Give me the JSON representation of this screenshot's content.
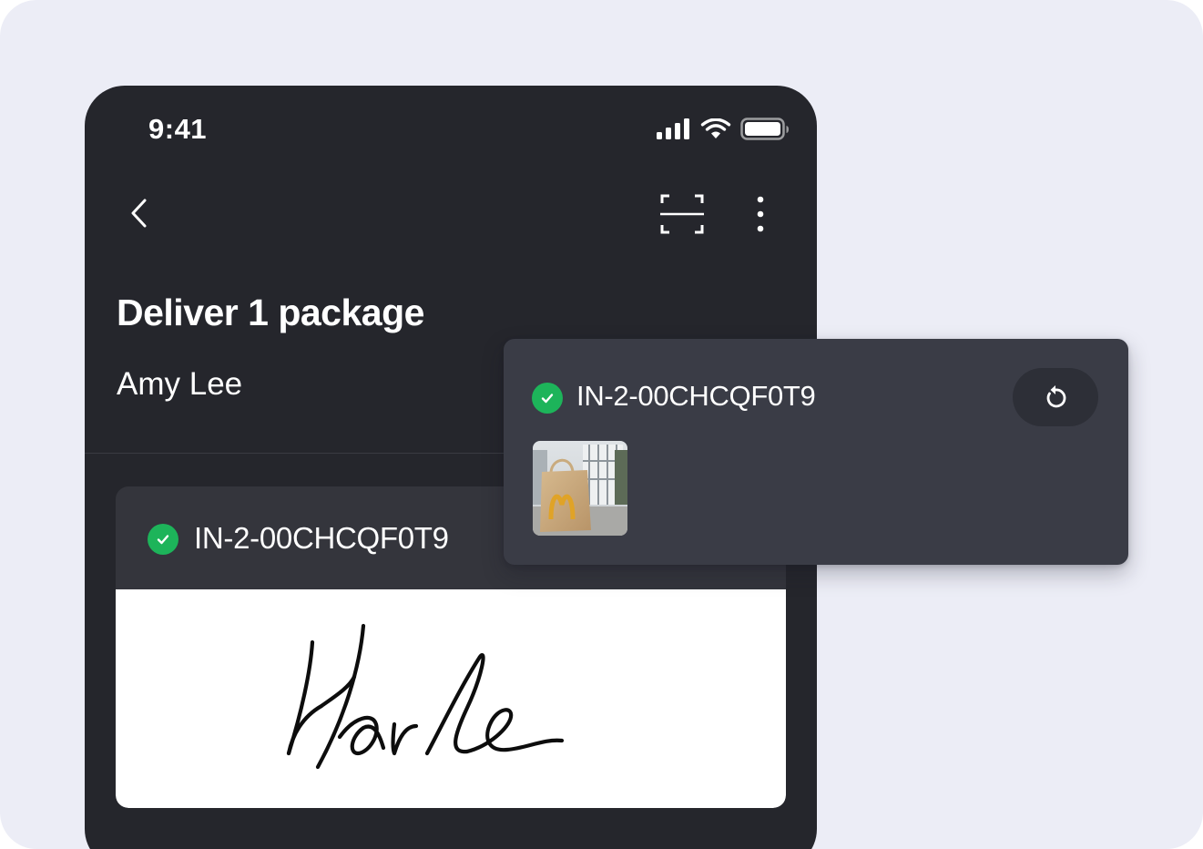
{
  "status_bar": {
    "time": "9:41",
    "icons": [
      "signal-icon",
      "wifi-icon",
      "battery-icon"
    ]
  },
  "toolbar": {
    "icons": [
      "back-chevron-icon",
      "scan-icon",
      "more-vertical-icon"
    ]
  },
  "delivery": {
    "title": "Deliver 1 package",
    "recipient": "Amy Lee"
  },
  "package": {
    "id": "IN-2-00CHCQF0T9",
    "status_icon": "check-circle-icon",
    "signature_label": "Harle"
  },
  "overlay": {
    "id": "IN-2-00CHCQF0T9",
    "status_icon": "check-circle-icon",
    "reset_icon": "refresh-icon",
    "photo_icon": "delivery-photo"
  },
  "colors": {
    "background": "#ecedf6",
    "phone": "#25262c",
    "card": "#34353c",
    "overlay": "#3a3c46",
    "success": "#1db45a"
  }
}
